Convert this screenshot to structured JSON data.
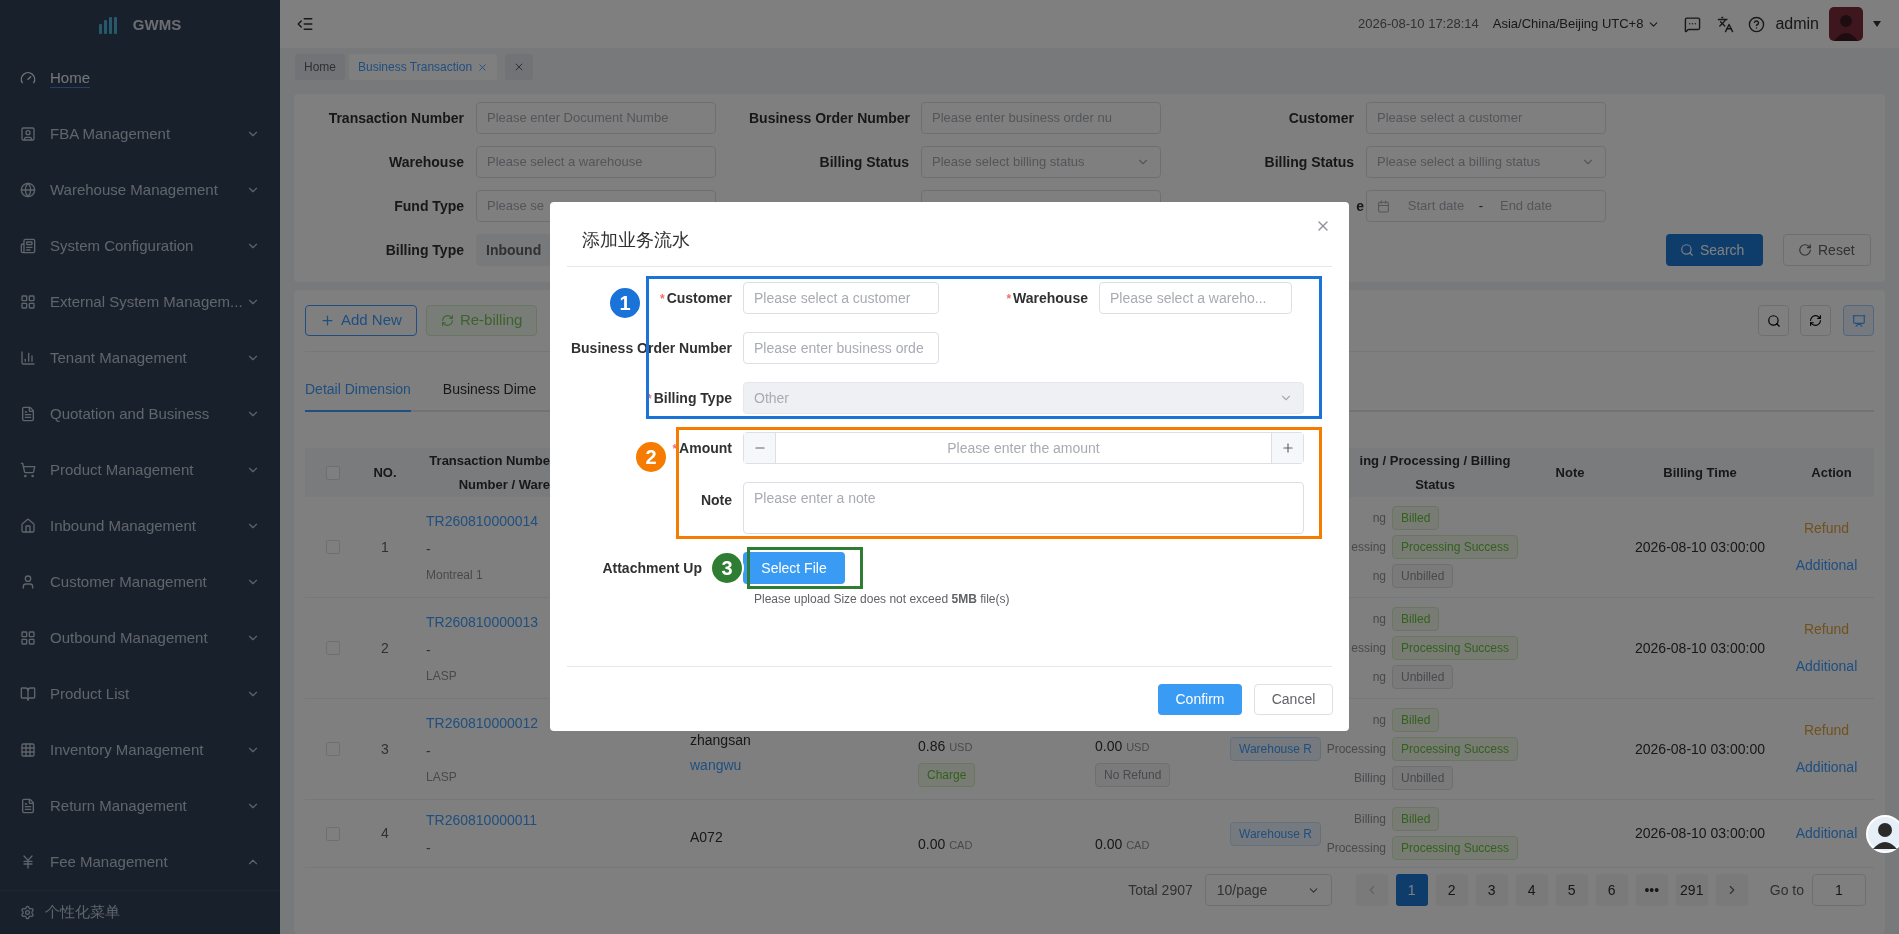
{
  "app": {
    "logo": "GWMS"
  },
  "sidebar": {
    "items": [
      {
        "label": "Home",
        "kind": "gauge",
        "selected": true,
        "has_submenu": false
      },
      {
        "label": "FBA Management",
        "kind": "badge",
        "selected": false,
        "has_submenu": true,
        "expanded": false
      },
      {
        "label": "Warehouse Management",
        "kind": "globe",
        "selected": false,
        "has_submenu": true,
        "expanded": false
      },
      {
        "label": "System Configuration",
        "kind": "newspaper",
        "selected": false,
        "has_submenu": true,
        "expanded": false
      },
      {
        "label": "External System Managem...",
        "kind": "tiles",
        "selected": false,
        "has_submenu": true,
        "expanded": false
      },
      {
        "label": "Tenant Management",
        "kind": "bars",
        "selected": false,
        "has_submenu": true,
        "expanded": false
      },
      {
        "label": "Quotation and Business",
        "kind": "file",
        "selected": false,
        "has_submenu": true,
        "expanded": false
      },
      {
        "label": "Product Management",
        "kind": "cart",
        "selected": false,
        "has_submenu": true,
        "expanded": false
      },
      {
        "label": "Inbound Management",
        "kind": "house",
        "selected": false,
        "has_submenu": true,
        "expanded": false
      },
      {
        "label": "Customer Management",
        "kind": "user",
        "selected": false,
        "has_submenu": true,
        "expanded": false
      },
      {
        "label": "Outbound Management",
        "kind": "tiles",
        "selected": false,
        "has_submenu": true,
        "expanded": false
      },
      {
        "label": "Product List",
        "kind": "book",
        "selected": false,
        "has_submenu": true,
        "expanded": false
      },
      {
        "label": "Inventory Management",
        "kind": "table",
        "selected": false,
        "has_submenu": true,
        "expanded": false
      },
      {
        "label": "Return Management",
        "kind": "file",
        "selected": false,
        "has_submenu": true,
        "expanded": false
      },
      {
        "label": "Fee Management",
        "kind": "yen",
        "selected": false,
        "has_submenu": true,
        "expanded": true
      }
    ],
    "footer": "个性化菜单"
  },
  "header": {
    "datetime": "2026-08-10 17:28:14",
    "timezone": "Asia/China/Beijing UTC+8",
    "user": "admin"
  },
  "tags": [
    {
      "label": "Home",
      "selected": false,
      "closable": false
    },
    {
      "label": "Business Transaction",
      "selected": true,
      "closable": true
    }
  ],
  "filters": {
    "rows": [
      [
        {
          "label": "Transaction Number",
          "kind": "input",
          "placeholder": "Please enter Document Numbe"
        },
        {
          "label": "Business Order Number",
          "kind": "input",
          "placeholder": "Please enter business order nu"
        },
        {
          "label": "Customer",
          "kind": "input",
          "placeholder": "Please select a customer"
        }
      ],
      [
        {
          "label": "Warehouse",
          "kind": "input",
          "placeholder": "Please select a warehouse"
        },
        {
          "label": "Billing Status",
          "kind": "select",
          "placeholder": "Please select billing status"
        },
        {
          "label": "Billing Status",
          "kind": "select",
          "placeholder": "Please select a billing status"
        }
      ],
      [
        {
          "label": "Fund Type",
          "kind": "input",
          "placeholder": "Please se"
        },
        {
          "kind": "input"
        },
        {
          "label": "e",
          "kind": "date",
          "start": "Start date",
          "separator": "-",
          "end": "End date"
        }
      ],
      [
        {
          "label": "Billing Type",
          "kind": "chip",
          "value": "Inbound"
        }
      ]
    ],
    "buttons": [
      {
        "label": "Search",
        "kind": "primary"
      },
      {
        "label": "Reset",
        "kind": "default"
      }
    ]
  },
  "toolbar": {
    "buttons": [
      {
        "label": "Add New",
        "kind": "outline",
        "disabled": false
      },
      {
        "label": "Re-billing",
        "kind": "success",
        "disabled": true
      }
    ]
  },
  "view_tabs": [
    {
      "label": "Detail Dimension",
      "selected": true
    },
    {
      "label": "Business Dime",
      "selected": false
    }
  ],
  "table": {
    "header_checked": false,
    "columns": {
      "no": "NO.",
      "transaction": [
        "Transaction Numbe",
        "Number / Ware"
      ],
      "status": [
        "ing / Processing / Billing",
        "Status"
      ],
      "note": "Note",
      "billing_time": "Billing Time",
      "action": "Action"
    },
    "rows": [
      {
        "checked": false,
        "no": "1",
        "transaction": {
          "number": "TR260810000014",
          "order": "-",
          "warehouse": "Montreal 1"
        },
        "statuses": [
          {
            "label": "ng",
            "tag": "Billed",
            "kind": "success"
          },
          {
            "label": "essing",
            "tag": "Processing Success",
            "kind": "success"
          },
          {
            "label": "ng",
            "tag": "Unbilled",
            "kind": "info"
          }
        ],
        "billing_time": "2026-08-10 03:00:00",
        "actions": [
          {
            "label": "Refund",
            "kind": "warning"
          },
          {
            "label": "Additional",
            "kind": "primary"
          }
        ]
      },
      {
        "checked": false,
        "no": "2",
        "transaction": {
          "number": "TR260810000013",
          "order": "-",
          "warehouse": "LASP"
        },
        "statuses": [
          {
            "label": "ng",
            "tag": "Billed",
            "kind": "success"
          },
          {
            "label": "essing",
            "tag": "Processing Success",
            "kind": "success"
          },
          {
            "label": "ng",
            "tag": "Unbilled",
            "kind": "info"
          }
        ],
        "billing_time": "2026-08-10 03:00:00",
        "actions": [
          {
            "label": "Refund",
            "kind": "warning"
          },
          {
            "label": "Additional",
            "kind": "primary"
          }
        ]
      },
      {
        "checked": false,
        "no": "3",
        "transaction": {
          "number": "TR260810000012",
          "order": "-",
          "warehouse": "LASP"
        },
        "customer": {
          "name": "zhangsan",
          "link": "wangwu"
        },
        "amount": {
          "value": "0.86",
          "currency": "USD",
          "tag": "Charge"
        },
        "refund": {
          "value": "0.00",
          "currency": "USD",
          "tag": "No Refund"
        },
        "business_type": "Warehouse R",
        "statuses": [
          {
            "label": "ng",
            "tag": "Billed",
            "kind": "success"
          },
          {
            "label": "Processing",
            "tag": "Processing Success",
            "kind": "success"
          },
          {
            "label": "Billing",
            "tag": "Unbilled",
            "kind": "info"
          }
        ],
        "billing_time": "2026-08-10 03:00:00",
        "actions": [
          {
            "label": "Refund",
            "kind": "warning"
          },
          {
            "label": "Additional",
            "kind": "primary"
          }
        ]
      },
      {
        "checked": false,
        "no": "4",
        "transaction": {
          "number": "TR260810000011",
          "order": "-"
        },
        "customer": {
          "name": "A072"
        },
        "amount": {
          "value": "0.00",
          "currency": "CAD"
        },
        "refund": {
          "value": "0.00",
          "currency": "CAD"
        },
        "business_type": "Warehouse R",
        "statuses": [
          {
            "label": "Billing",
            "tag": "Billed",
            "kind": "success"
          },
          {
            "label": "Processing",
            "tag": "Processing Success",
            "kind": "success"
          }
        ],
        "billing_time": "2026-08-10 03:00:00",
        "actions": [
          {
            "label": "Additional",
            "kind": "primary"
          }
        ]
      }
    ]
  },
  "pagination": {
    "total": "Total 2907",
    "page_size": "10/page",
    "prev_disabled": true,
    "pages": [
      {
        "label": "1",
        "selected": true
      },
      {
        "label": "2",
        "selected": false
      },
      {
        "label": "3",
        "selected": false
      },
      {
        "label": "4",
        "selected": false
      },
      {
        "label": "5",
        "selected": false
      },
      {
        "label": "6",
        "selected": false
      },
      {
        "label": "•••",
        "selected": false
      },
      {
        "label": "291",
        "selected": false
      }
    ],
    "goto_label": "Go to",
    "goto_value": "1"
  },
  "modal": {
    "title": "添加业务流水",
    "required_mark": "*",
    "rows": [
      [
        {
          "label": "Customer",
          "required": true,
          "kind": "input",
          "placeholder": "Please select a customer"
        },
        {
          "label": "Warehouse",
          "required": true,
          "kind": "input",
          "placeholder": "Please select a wareho..."
        }
      ],
      [
        {
          "label": "Business Order Number",
          "required": false,
          "kind": "input",
          "placeholder": "Please enter business orde"
        }
      ],
      [
        {
          "label": "Billing Type",
          "required": true,
          "kind": "select",
          "value": "Other",
          "disabled": true
        }
      ],
      [
        {
          "label": "Amount",
          "required": true,
          "kind": "number",
          "placeholder": "Please enter the amount"
        }
      ],
      [
        {
          "label": "Note",
          "required": false,
          "kind": "textarea",
          "placeholder": "Please enter a note"
        }
      ]
    ],
    "upload": {
      "label": "Attachment Up",
      "button": "Select File",
      "hint": "Please upload Size does not exceed **5MB** file(s)"
    },
    "buttons": [
      {
        "label": "Confirm",
        "kind": "primary"
      },
      {
        "label": "Cancel",
        "kind": "default"
      }
    ]
  },
  "annotations": [
    {
      "label": "1",
      "color": "#1a73d9"
    },
    {
      "label": "2",
      "color": "#f57c00"
    },
    {
      "label": "3",
      "color": "#2e7d32"
    }
  ]
}
